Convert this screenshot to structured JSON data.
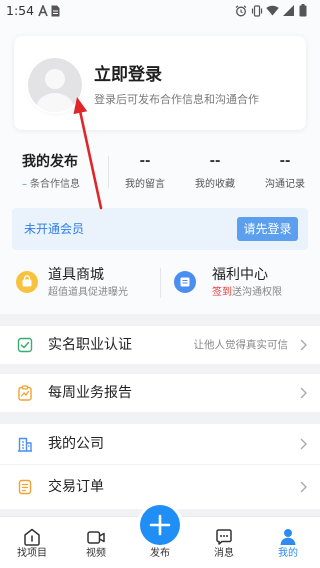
{
  "status_bar": {
    "time": "1:54",
    "left_icons": [
      "a-notification-icon",
      "document-notification-icon"
    ],
    "right_icons": [
      "alarm-icon",
      "vibrate-icon",
      "wifi-icon",
      "signal-icon",
      "battery-icon"
    ]
  },
  "profile": {
    "title": "立即登录",
    "subtitle": "登录后可发布合作信息和沟通合作",
    "icon": "default-avatar-icon"
  },
  "stats": {
    "publish": {
      "title": "我的发布",
      "count": "–",
      "unit": "条合作信息"
    },
    "items": [
      {
        "value": "--",
        "label": "我的留言"
      },
      {
        "value": "--",
        "label": "我的收藏"
      },
      {
        "value": "--",
        "label": "沟通记录"
      }
    ]
  },
  "membership": {
    "status": "未开通会员",
    "button_label": "请先登录"
  },
  "features": [
    {
      "title": "道具商城",
      "subtitle": "超值道具促进曝光",
      "icon": "shop-icon",
      "color": "#f7c33e"
    },
    {
      "title": "福利中心",
      "subtitle_highlight": "签到",
      "subtitle_rest": "送沟通权限",
      "icon": "gift-icon",
      "color": "#4b8ef1"
    }
  ],
  "menu": [
    {
      "label": "实名职业认证",
      "hint": "让他人觉得真实可信",
      "icon": "verified-check-icon",
      "color": "#3bab72"
    },
    {
      "label": "每周业务报告",
      "icon": "clipboard-report-icon",
      "color": "#f2a232"
    },
    {
      "label": "我的公司",
      "icon": "company-building-icon",
      "color": "#4b8ef1"
    },
    {
      "label": "交易订单",
      "icon": "order-document-icon",
      "color": "#f2a232"
    }
  ],
  "tabbar": {
    "items": [
      {
        "label": "找项目",
        "icon": "project-home-icon"
      },
      {
        "label": "视频",
        "icon": "video-icon"
      },
      {
        "label": "发布",
        "icon": "plus-icon"
      },
      {
        "label": "消息",
        "icon": "message-icon"
      },
      {
        "label": "我的",
        "icon": "profile-icon",
        "active": true
      }
    ]
  },
  "colors": {
    "accent": "#2d8cf0",
    "highlight_red": "#e53935",
    "annotation_red": "#e0252b",
    "membership_bg": "#eaf2fc"
  }
}
